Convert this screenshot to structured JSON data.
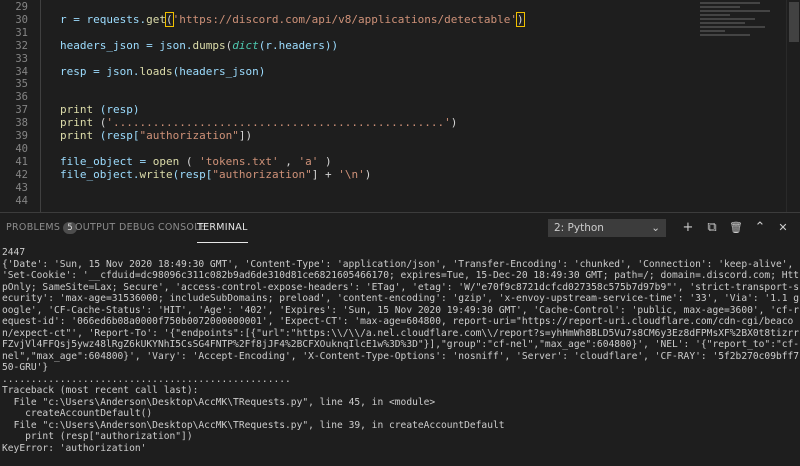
{
  "editor": {
    "lines": [
      {
        "n": "29",
        "segments": []
      },
      {
        "n": "30",
        "segments": [
          {
            "t": "r = requests.",
            "c": "v"
          },
          {
            "t": "get",
            "c": "f"
          },
          {
            "t": "(",
            "c": "",
            "hl": true
          },
          {
            "t": "'https://discord.com/api/v8/applications/detectable'",
            "c": "s"
          },
          {
            "t": ")",
            "c": "",
            "hl": true
          }
        ]
      },
      {
        "n": "31",
        "segments": []
      },
      {
        "n": "32",
        "segments": [
          {
            "t": "headers_json = json.",
            "c": "v"
          },
          {
            "t": "dumps",
            "c": "f"
          },
          {
            "t": "(",
            "c": ""
          },
          {
            "t": "dict",
            "c": "k"
          },
          {
            "t": "(r.headers))",
            "c": "v"
          }
        ]
      },
      {
        "n": "33",
        "segments": []
      },
      {
        "n": "34",
        "segments": [
          {
            "t": "resp = json.",
            "c": "v"
          },
          {
            "t": "loads",
            "c": "f"
          },
          {
            "t": "(headers_json)",
            "c": "v"
          }
        ]
      },
      {
        "n": "35",
        "segments": []
      },
      {
        "n": "36",
        "segments": []
      },
      {
        "n": "37",
        "segments": [
          {
            "t": "print",
            "c": "f"
          },
          {
            "t": " (resp)",
            "c": "v"
          }
        ]
      },
      {
        "n": "38",
        "segments": [
          {
            "t": "print",
            "c": "f"
          },
          {
            "t": " (",
            "c": ""
          },
          {
            "t": "'..................................................'",
            "c": "s"
          },
          {
            "t": ")",
            "c": ""
          }
        ]
      },
      {
        "n": "39",
        "segments": [
          {
            "t": "print",
            "c": "f"
          },
          {
            "t": " (resp[",
            "c": "v"
          },
          {
            "t": "\"authorization\"",
            "c": "s"
          },
          {
            "t": "])",
            "c": ""
          }
        ]
      },
      {
        "n": "40",
        "segments": []
      },
      {
        "n": "41",
        "segments": [
          {
            "t": "file_object = ",
            "c": "v"
          },
          {
            "t": "open",
            "c": "f"
          },
          {
            "t": " ( ",
            "c": ""
          },
          {
            "t": "'tokens.txt'",
            "c": "s"
          },
          {
            "t": " , ",
            "c": ""
          },
          {
            "t": "'a'",
            "c": "s"
          },
          {
            "t": " )",
            "c": ""
          }
        ]
      },
      {
        "n": "42",
        "segments": [
          {
            "t": "file_object.",
            "c": "v"
          },
          {
            "t": "write",
            "c": "f"
          },
          {
            "t": "(resp[",
            "c": "v"
          },
          {
            "t": "\"authorization\"",
            "c": "s"
          },
          {
            "t": "] + ",
            "c": ""
          },
          {
            "t": "'\\n'",
            "c": "s"
          },
          {
            "t": ")",
            "c": ""
          }
        ]
      },
      {
        "n": "43",
        "segments": []
      },
      {
        "n": "44",
        "segments": []
      }
    ]
  },
  "panel": {
    "tabs": [
      {
        "label": "PROBLEMS",
        "badge": "5",
        "active": false
      },
      {
        "label": "OUTPUT",
        "active": false
      },
      {
        "label": "DEBUG CONSOLE",
        "active": false
      },
      {
        "label": "TERMINAL",
        "active": true
      }
    ],
    "terminal_select": "2: Python",
    "tools": {
      "add": "+",
      "split": "⧉",
      "trash": "🗑",
      "maximize": "⌃",
      "close": "✕"
    }
  },
  "terminal": {
    "lines": [
      "2447",
      "{'Date': 'Sun, 15 Nov 2020 18:49:30 GMT', 'Content-Type': 'application/json', 'Transfer-Encoding': 'chunked', 'Connection': 'keep-alive', 'Set-Cookie': '__cfduid=dc98096c311c082b9ad6de310d81ce6821605466170; expires=Tue, 15-Dec-20 18:49:30 GMT; path=/; domain=.discord.com; HttpOnly; SameSite=Lax; Secure', 'access-control-expose-headers': 'ETag', 'etag': 'W/\"e70f9c8721dcfcd027358c575b7d97b9\"', 'strict-transport-security': 'max-age=31536000; includeSubDomains; preload', 'content-encoding': 'gzip', 'x-envoy-upstream-service-time': '33', 'Via': '1.1 google', 'CF-Cache-Status': 'HIT', 'Age': '402', 'Expires': 'Sun, 15 Nov 2020 19:49:30 GMT', 'Cache-Control': 'public, max-age=3600', 'cf-request-id': '066ed6b08a0000f750b0072000000001', 'Expect-CT': 'max-age=604800, report-uri=\"https://report-uri.cloudflare.com/cdn-cgi/beacon/expect-ct\"', 'Report-To': '{\"endpoints\":[{\"url\":\"https:\\\\/\\\\/a.nel.cloudflare.com\\\\/report?s=yhHmWh8BLD5Vu7s8CM6y3Ez8dFPMsXF%2BX0t8tizrrFZvjVl4FFQsj5ywz48lRgZ6kUKYNhI5CsSG4FNTP%2Ff8jJF4%2BCFXOuknqIlcE1w%3D%3D\"}],\"group\":\"cf-nel\",\"max_age\":604800}', 'NEL': '{\"report_to\":\"cf-nel\",\"max_age\":604800}', 'Vary': 'Accept-Encoding', 'X-Content-Type-Options': 'nosniff', 'Server': 'cloudflare', 'CF-RAY': '5f2b270c09bff750-GRU'}",
      "..................................................",
      "Traceback (most recent call last):",
      "  File \"c:\\Users\\Anderson\\Desktop\\AccMK\\TRequests.py\", line 45, in <module>",
      "    createAccountDefault()",
      "  File \"c:\\Users\\Anderson\\Desktop\\AccMK\\TRequests.py\", line 39, in createAccountDefault",
      "    print (resp[\"authorization\"])",
      "KeyError: 'authorization'"
    ]
  }
}
